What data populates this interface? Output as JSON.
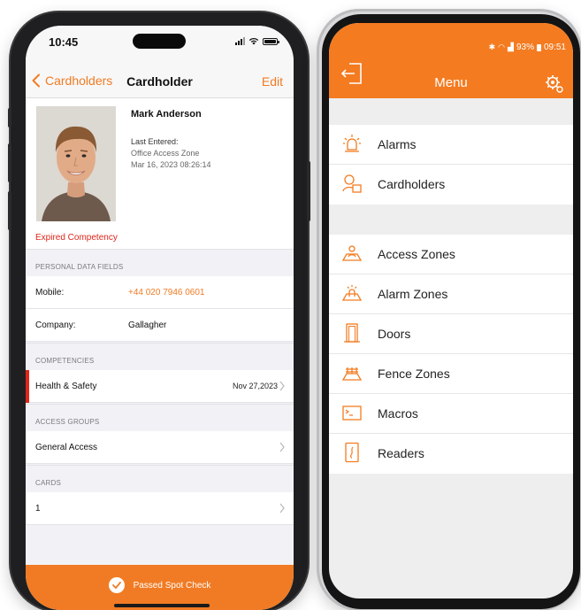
{
  "left_phone": {
    "status_time": "10:45",
    "nav": {
      "back_label": "Cardholders",
      "title": "Cardholder",
      "edit_label": "Edit"
    },
    "profile": {
      "name": "Mark Anderson",
      "last_entered_label": "Last Entered:",
      "last_entered_zone": "Office Access Zone",
      "last_entered_time": "Mar 16, 2023 08:26:14",
      "competency_alert": "Expired Competency"
    },
    "personal": {
      "header": "PERSONAL DATA FIELDS",
      "mobile_label": "Mobile:",
      "mobile_value": "+44 020 7946 0601",
      "company_label": "Company:",
      "company_value": "Gallagher"
    },
    "competencies": {
      "header": "COMPETENCIES",
      "name": "Health & Safety",
      "date": "Nov 27,2023"
    },
    "access_groups": {
      "header": "ACCESS GROUPS",
      "name": "General Access"
    },
    "cards": {
      "header": "CARDS",
      "value": "1"
    },
    "bottom_action": "Passed Spot Check",
    "colors": {
      "accent": "#f07b24",
      "alert": "#e0251b"
    }
  },
  "right_phone": {
    "status": {
      "battery": "93%",
      "time": "09:51"
    },
    "title": "Menu",
    "group1": [
      {
        "label": "Alarms",
        "icon": "siren-icon"
      },
      {
        "label": "Cardholders",
        "icon": "cardholder-icon"
      }
    ],
    "group2": [
      {
        "label": "Access Zones",
        "icon": "access-zone-icon"
      },
      {
        "label": "Alarm Zones",
        "icon": "alarm-zone-icon"
      },
      {
        "label": "Doors",
        "icon": "door-icon"
      },
      {
        "label": "Fence Zones",
        "icon": "fence-icon"
      },
      {
        "label": "Macros",
        "icon": "terminal-icon"
      },
      {
        "label": "Readers",
        "icon": "reader-icon"
      }
    ],
    "colors": {
      "accent": "#f47b20"
    }
  }
}
